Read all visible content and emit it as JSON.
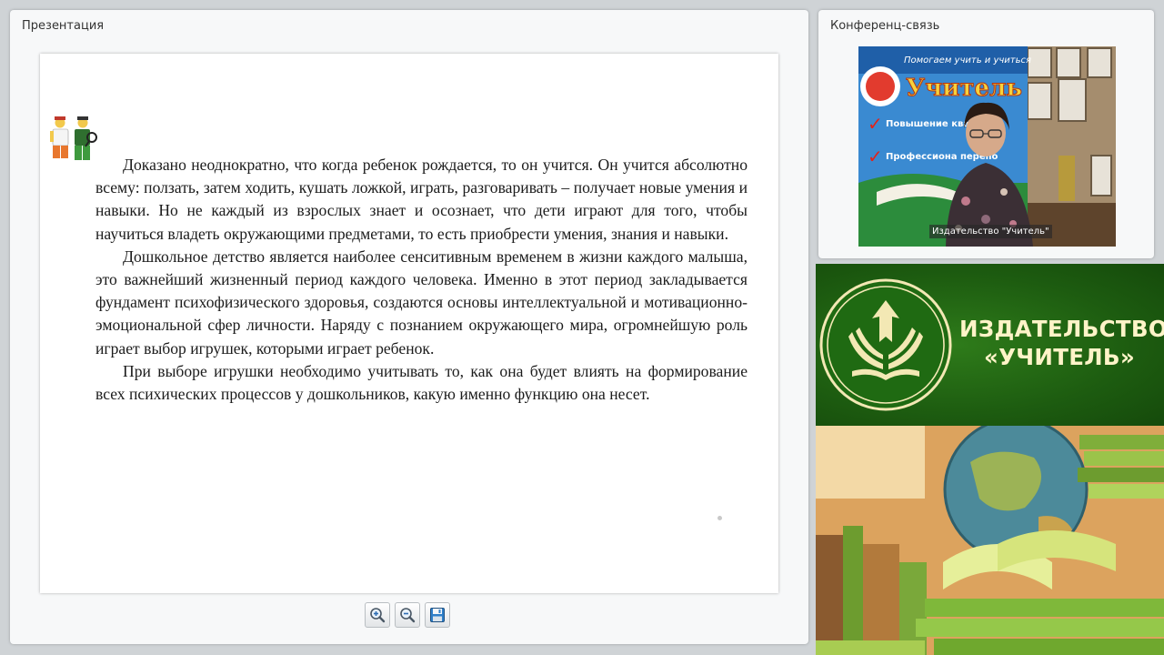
{
  "presentation": {
    "title": "Презентация",
    "paragraphs": [
      "Доказано неоднократно, что когда ребенок рождается, то он учится. Он учится абсолютно всему: ползать, затем ходить, кушать ложкой, играть, разговаривать – получает новые умения и навыки. Но не каждый из взрослых знает и осознает, что дети играют для того, чтобы научиться владеть окружающими предметами, то есть приобрести умения, знания и навыки.",
      "Дошкольное детство является наиболее сенситивным временем в жизни каждого малыша, это важнейший жизненный период каждого человека. Именно в этот период закладывается фундамент психофизического здоровья, создаются основы интеллектуальной и мотивационно-эмоциональной сфер личности. Наряду с познанием окружающего мира, огромнейшую роль играет выбор игрушек, которыми играет ребенок.",
      "При выборе игрушки необходимо учитывать то, как она будет влиять на формирование всех психических процессов у дошкольников, какую именно функцию она несет."
    ],
    "toolbar": {
      "zoom_in_icon": "zoom-in-icon",
      "zoom_out_icon": "zoom-out-icon",
      "save_icon": "floppy-disk-icon"
    }
  },
  "conference": {
    "title": "Конференц-связь",
    "video_caption": "Издательство \"Учитель\"",
    "banner_text_line1": "Помогаем учить и учиться",
    "banner_text_line2": "Учитель",
    "banner_items": [
      "Повышение квалиф",
      "Профессиона перепо"
    ]
  },
  "brand": {
    "name_line1": "ИЗДАТЕЛЬСТВО",
    "name_line2": "«УЧИТЕЛЬ»",
    "colors": {
      "banner_green": "#1d5c10",
      "logo_cream": "#fff4c8"
    }
  }
}
